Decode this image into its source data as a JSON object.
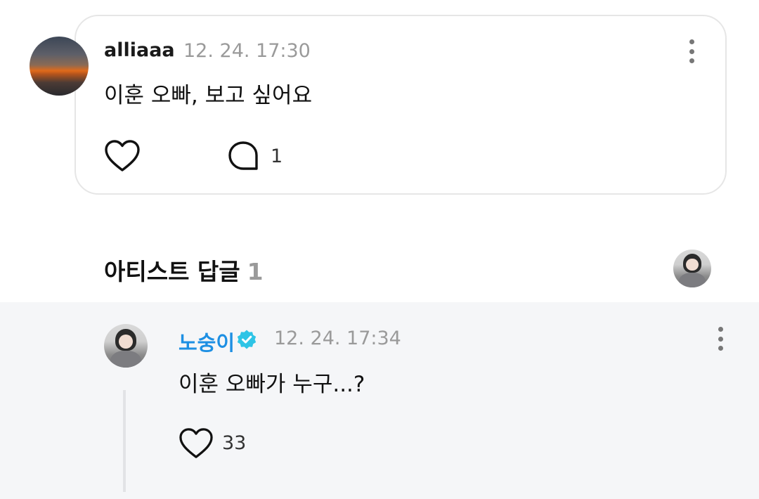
{
  "comment": {
    "username": "alliaaa",
    "timestamp": "12. 24. 17:30",
    "text": "이훈 오빠, 보고 싶어요",
    "like_icon": "heart-outline-icon",
    "reply_icon": "speech-bubble-icon",
    "reply_count": "1"
  },
  "artist_section": {
    "title": "아티스트 답글",
    "count": "1"
  },
  "reply": {
    "username": "노숭이",
    "verified_icon": "verified-badge-icon",
    "timestamp": "12. 24. 17:34",
    "text": "이훈 오빠가 누구...?",
    "like_icon": "heart-outline-icon",
    "like_count": "33"
  },
  "colors": {
    "artist_name": "#1d8fe3",
    "verified_badge": "#2ec4e6",
    "reply_background": "#f5f6f8",
    "timestamp": "#9a9a9a"
  }
}
